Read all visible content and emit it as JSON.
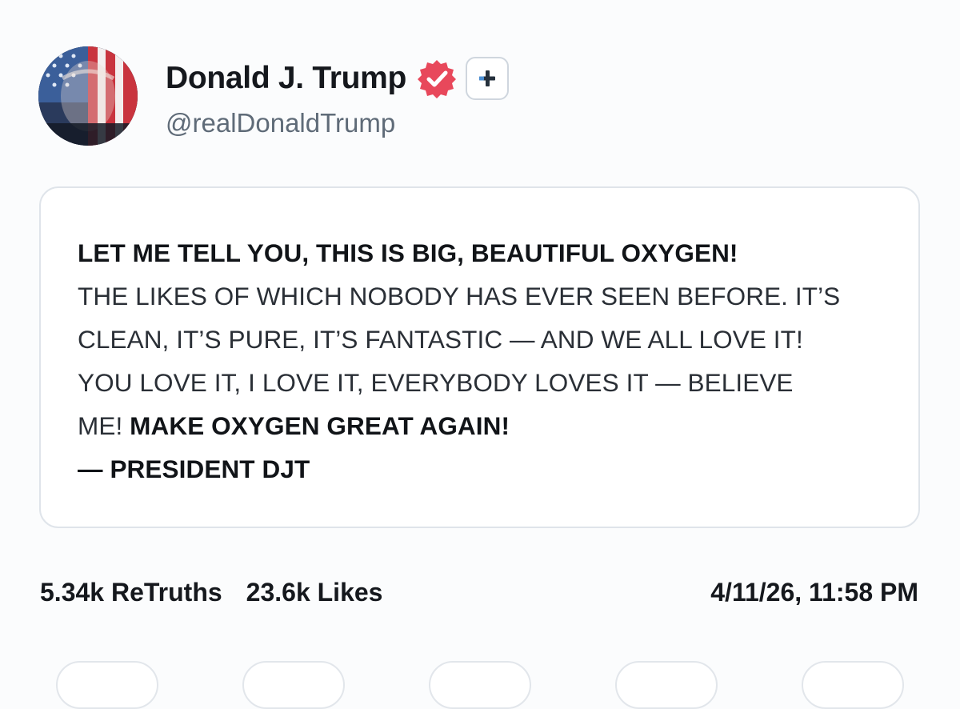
{
  "profile": {
    "display_name": "Donald J. Trump",
    "handle": "@realDonaldTrump",
    "avatar": "avatar-flag-portrait",
    "verified_icon": "verified-badge-icon",
    "follow_icon": "plus-icon"
  },
  "post": {
    "headline": "LET ME TELL YOU, THIS IS BIG, BEAUTIFUL OXYGEN!",
    "line_2": "THE LIKES OF WHICH NOBODY HAS EVER SEEN BEFORE. IT’S",
    "line_3": "CLEAN, IT’S PURE, IT’S FANTASTIC — AND WE ALL LOVE IT!",
    "line_4": "YOU LOVE IT, I LOVE IT, EVERYBODY LOVES IT — BELIEVE",
    "line_5_plain": "ME! ",
    "line_5_bold": "MAKE OXYGEN GREAT AGAIN!",
    "signature": "— PRESIDENT DJT"
  },
  "stats": {
    "retruths": "5.34k ReTruths",
    "likes": "23.6k Likes",
    "timestamp": "4/11/26, 11:58 PM"
  },
  "colors": {
    "verified_badge": "#e8485b",
    "plus_icon_accent": "#4a8fd4",
    "text_primary": "#111418",
    "text_secondary": "#5f6b78",
    "card_border": "#dfe4ea"
  }
}
